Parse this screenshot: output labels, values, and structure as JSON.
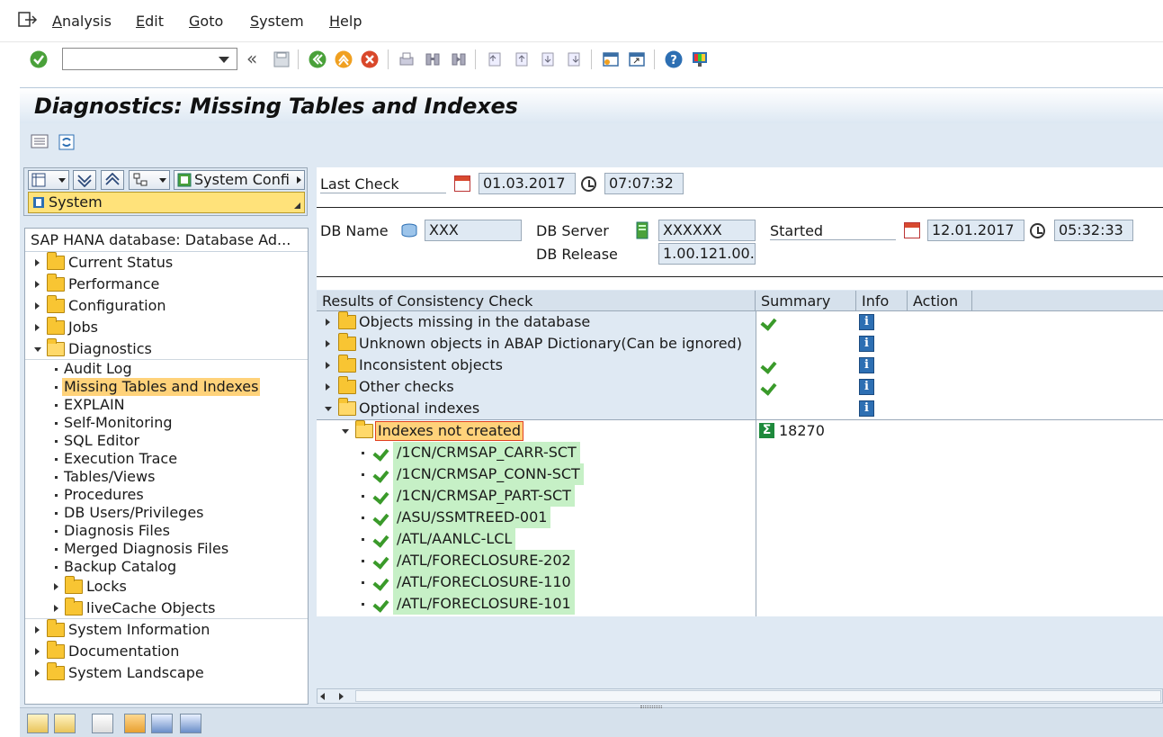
{
  "menu": {
    "items": [
      "Analysis",
      "Edit",
      "Goto",
      "System",
      "Help"
    ]
  },
  "toolbar": {
    "command_value": "",
    "icons": [
      "enter-icon",
      "save-icon",
      "back-icon",
      "exit-icon",
      "cancel-icon",
      "print-icon",
      "find-icon",
      "find-next-icon",
      "first-page-icon",
      "previous-page-icon",
      "next-page-icon",
      "last-page-icon",
      "new-session-icon",
      "shortcut-icon",
      "help-icon",
      "customize-layout-icon"
    ]
  },
  "title": "Diagnostics: Missing Tables and Indexes",
  "left_panel": {
    "system_config_label": "System Confi",
    "system_label": "System",
    "tree_header": "SAP HANA database: Database Ad...",
    "top_items": [
      "Current Status",
      "Performance",
      "Configuration",
      "Jobs",
      "Diagnostics"
    ],
    "diagnostics_children": [
      "Audit Log",
      "Missing Tables and Indexes",
      "EXPLAIN",
      "Self-Monitoring",
      "SQL Editor",
      "Execution Trace",
      "Tables/Views",
      "Procedures",
      "DB Users/Privileges",
      "Diagnosis Files",
      "Merged Diagnosis Files",
      "Backup Catalog"
    ],
    "diagnostics_folders": [
      "Locks",
      "liveCache Objects"
    ],
    "bottom_items": [
      "System Information",
      "Documentation",
      "System Landscape"
    ]
  },
  "header": {
    "last_check_label": "Last Check",
    "last_check_date": "01.03.2017",
    "last_check_time": "07:07:32",
    "db_name_label": "DB Name",
    "db_name": "XXX",
    "db_server_label": "DB Server",
    "db_server": "XXXXXX",
    "db_release_label": "DB Release",
    "db_release": "1.00.121.00...",
    "started_label": "Started",
    "started_date": "12.01.2017",
    "started_time": "05:32:33"
  },
  "results": {
    "columns": [
      "Results of Consistency Check",
      "Summary",
      "Info",
      "Action"
    ],
    "categories": [
      {
        "label": "Objects missing in the database",
        "ok": true
      },
      {
        "label": "Unknown objects in ABAP Dictionary(Can be ignored)",
        "ok": false
      },
      {
        "label": "Inconsistent objects",
        "ok": true
      },
      {
        "label": "Other checks",
        "ok": true
      },
      {
        "label": "Optional indexes",
        "ok": false
      }
    ],
    "indexes_node": "Indexes not created",
    "indexes_count": "18270",
    "index_items": [
      "/1CN/CRMSAP_CARR-SCT",
      "/1CN/CRMSAP_CONN-SCT",
      "/1CN/CRMSAP_PART-SCT",
      "/ASU/SSMTREED-001",
      "/ATL/AANLC-LCL",
      "/ATL/FORECLOSURE-202",
      "/ATL/FORECLOSURE-110",
      "/ATL/FORECLOSURE-101"
    ]
  },
  "colors": {
    "accent": "#ffe27a",
    "selected": "#ffd27a",
    "ok_green": "#3a9a2a",
    "panel_bg": "#dfe9f3"
  }
}
